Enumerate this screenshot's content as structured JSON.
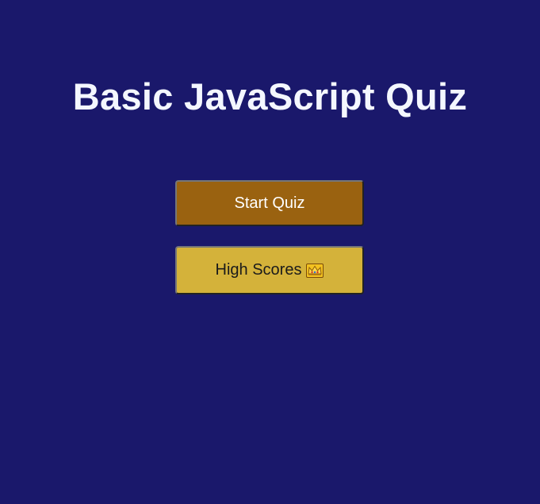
{
  "page": {
    "title": "Basic JavaScript Quiz",
    "background_color": "#1a186b"
  },
  "buttons": {
    "start_label": "Start Quiz",
    "start_color": "#9a6210",
    "high_scores_label": "High Scores",
    "high_scores_icon": "crown-icon",
    "high_scores_color": "#d4b23a"
  }
}
